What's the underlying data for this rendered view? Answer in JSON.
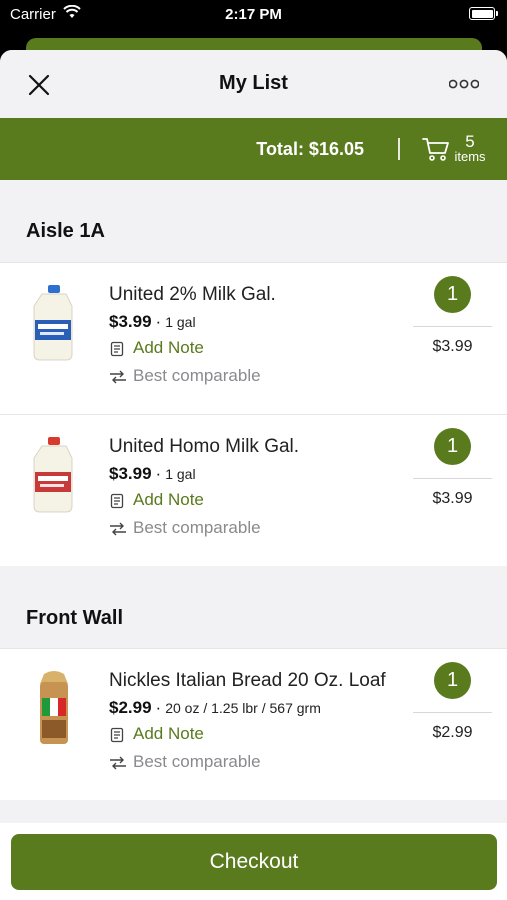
{
  "status_bar": {
    "carrier": "Carrier",
    "time": "2:17 PM"
  },
  "nav": {
    "title": "My List"
  },
  "summary": {
    "total_label": "Total: $16.05",
    "item_count": "5",
    "items_label": "items"
  },
  "sections": [
    {
      "label": "Aisle 1A",
      "items": [
        {
          "name": "United 2% Milk Gal.",
          "price": "$3.99",
          "size": "1 gal",
          "note": "Add Note",
          "comparable": "Best comparable",
          "quantity": "1",
          "line_total": "$3.99"
        },
        {
          "name": "United Homo Milk Gal.",
          "price": "$3.99",
          "size": "1 gal",
          "note": "Add Note",
          "comparable": "Best comparable",
          "quantity": "1",
          "line_total": "$3.99"
        }
      ]
    },
    {
      "label": "Front Wall",
      "items": [
        {
          "name": "Nickles Italian Bread 20 Oz. Loaf",
          "price": "$2.99",
          "size": "20 oz / 1.25 lbr / 567 grm",
          "note": "Add Note",
          "comparable": "Best comparable",
          "quantity": "1",
          "line_total": "$2.99"
        }
      ]
    }
  ],
  "checkout_label": "Checkout",
  "colors": {
    "accent": "#5a7a1e",
    "background": "#f2f2f4",
    "muted": "#8a8a8e"
  },
  "icons": {
    "close": "close-icon",
    "more": "more-icon",
    "cart": "cart-icon",
    "note": "note-icon",
    "swap": "swap-icon"
  }
}
